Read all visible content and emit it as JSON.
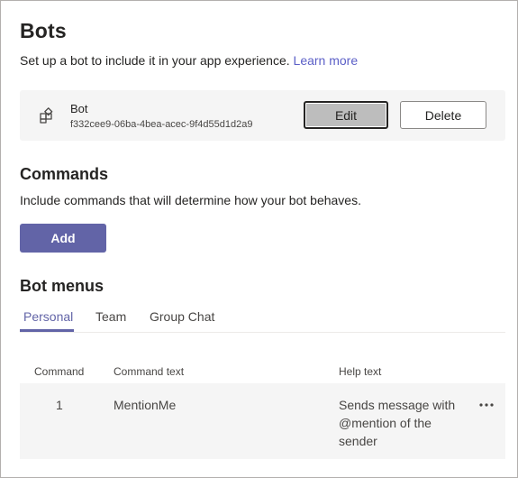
{
  "page": {
    "title": "Bots",
    "subtitle": "Set up a bot to include it in your app experience.",
    "learn_more": "Learn more"
  },
  "bot": {
    "icon": "bot-puzzle-icon",
    "name": "Bot",
    "id": "f332cee9-06ba-4bea-acec-9f4d55d1d2a9",
    "edit_label": "Edit",
    "delete_label": "Delete"
  },
  "commands": {
    "heading": "Commands",
    "description": "Include commands that will determine how your bot behaves.",
    "add_label": "Add"
  },
  "menus": {
    "heading": "Bot menus",
    "tabs": [
      {
        "label": "Personal",
        "active": true
      },
      {
        "label": "Team",
        "active": false
      },
      {
        "label": "Group Chat",
        "active": false
      }
    ],
    "columns": {
      "command": "Command",
      "command_text": "Command text",
      "help_text": "Help text"
    },
    "rows": [
      {
        "command": "1",
        "command_text": "MentionMe",
        "help_text": "Sends message with @mention of the sender"
      }
    ]
  },
  "colors": {
    "accent": "#6264a7",
    "link": "#5b5fc7",
    "card_bg": "#f5f5f5",
    "text": "#252423"
  }
}
